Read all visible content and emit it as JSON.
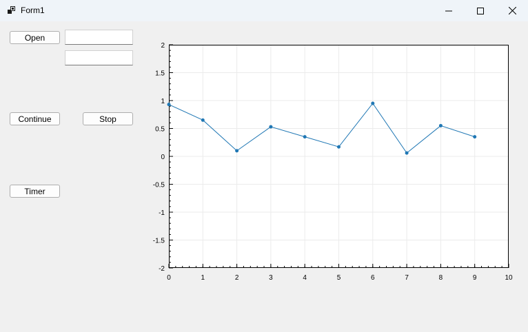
{
  "window": {
    "title": "Form1",
    "icon": "app-icon"
  },
  "controls": {
    "open_label": "Open",
    "continue_label": "Continue",
    "stop_label": "Stop",
    "timer_label": "Timer",
    "textbox1_value": "",
    "textbox2_value": ""
  },
  "chart_data": {
    "type": "line",
    "title": "",
    "xlabel": "",
    "ylabel": "",
    "x": [
      0,
      1,
      2,
      3,
      4,
      5,
      6,
      7,
      8,
      9
    ],
    "series": [
      {
        "values": [
          0.93,
          0.65,
          0.1,
          0.53,
          0.35,
          0.17,
          0.95,
          0.06,
          0.55,
          0.35
        ],
        "color": "#1f77b4"
      }
    ],
    "xlim": [
      0,
      10
    ],
    "ylim": [
      -2,
      2
    ],
    "xticks": [
      "0",
      "1",
      "2",
      "3",
      "4",
      "5",
      "6",
      "7",
      "8",
      "9",
      "10"
    ],
    "yticks": [
      "2",
      "1.5",
      "1",
      "0.5",
      "0",
      "-0.5",
      "-1",
      "-1.5",
      "-2"
    ],
    "grid": true
  }
}
